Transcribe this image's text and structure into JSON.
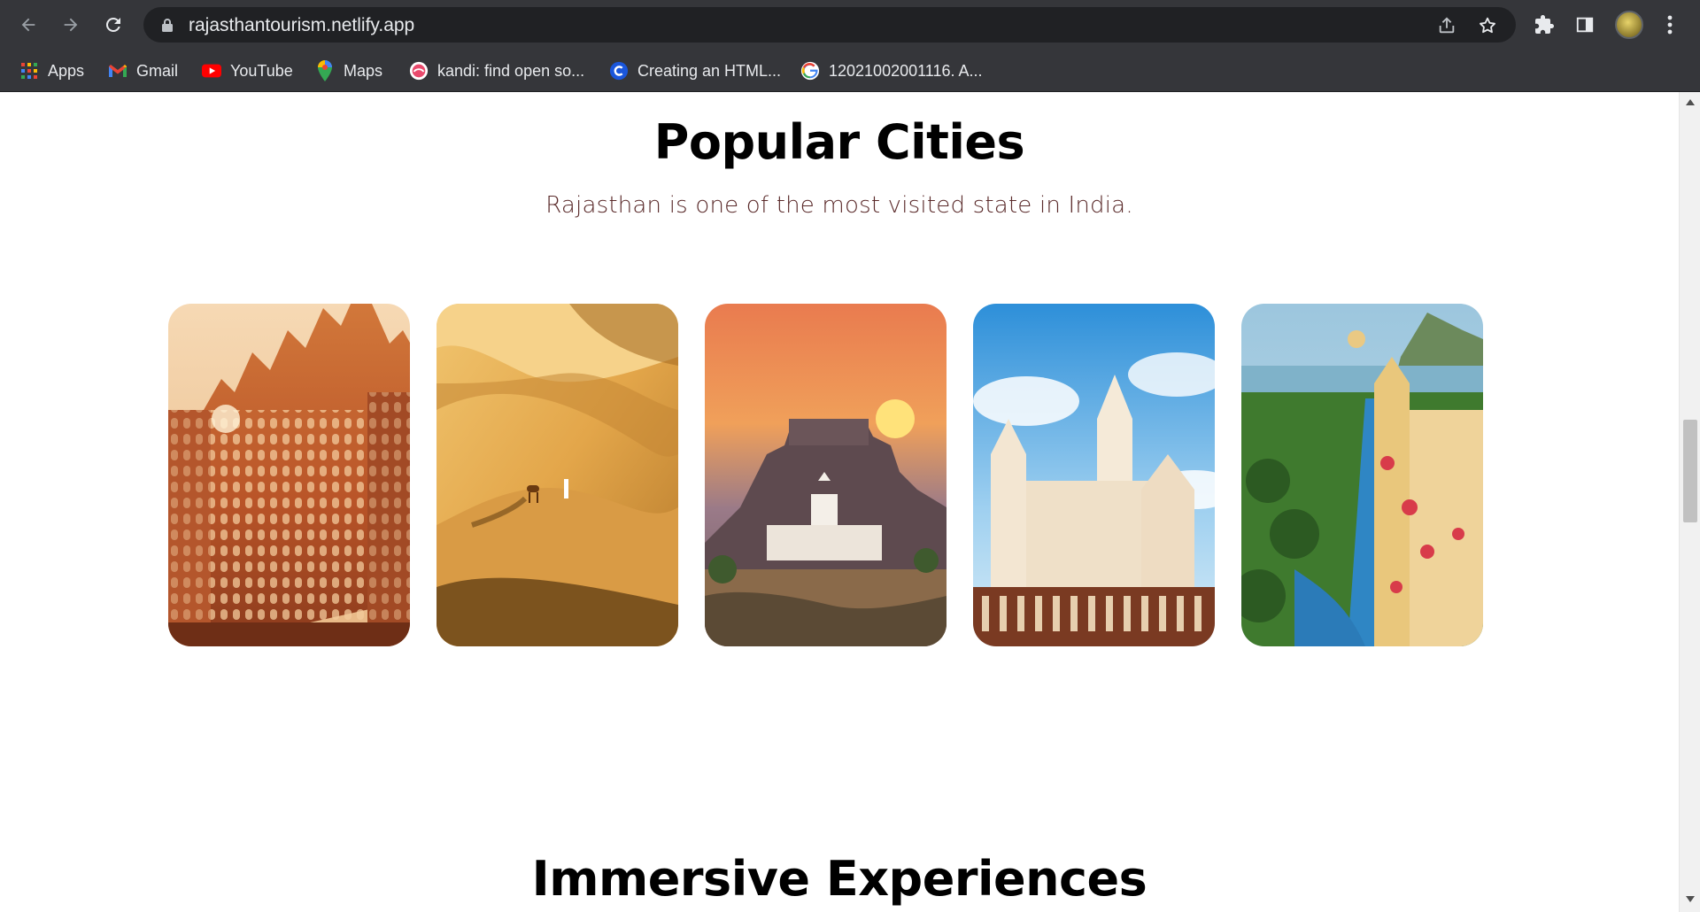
{
  "browser": {
    "url": "rajasthantourism.netlify.app",
    "bookmarks": [
      {
        "label": "Apps",
        "icon": "apps-grid-icon"
      },
      {
        "label": "Gmail",
        "icon": "gmail-icon"
      },
      {
        "label": "YouTube",
        "icon": "youtube-icon"
      },
      {
        "label": "Maps",
        "icon": "maps-pin-icon"
      },
      {
        "label": "kandi: find open so...",
        "icon": "kandi-icon"
      },
      {
        "label": "Creating an HTML...",
        "icon": "c-logo-icon"
      },
      {
        "label": "12021002001116. A...",
        "icon": "google-icon"
      }
    ]
  },
  "section": {
    "title": "Popular Cities",
    "subtitle": "Rajasthan is one of the most visited state in India."
  },
  "cities": [
    {
      "image": "hawa-mahal-palace-image"
    },
    {
      "image": "desert-dunes-camel-image"
    },
    {
      "image": "fort-sunset-image"
    },
    {
      "image": "white-marble-palace-image"
    },
    {
      "image": "lake-palace-pool-image"
    }
  ],
  "next_section": {
    "title": "Immersive Experiences"
  },
  "colors": {
    "chrome_bg": "#35363a",
    "omnibox_bg": "#202124",
    "subtitle": "#5a2a2a"
  }
}
